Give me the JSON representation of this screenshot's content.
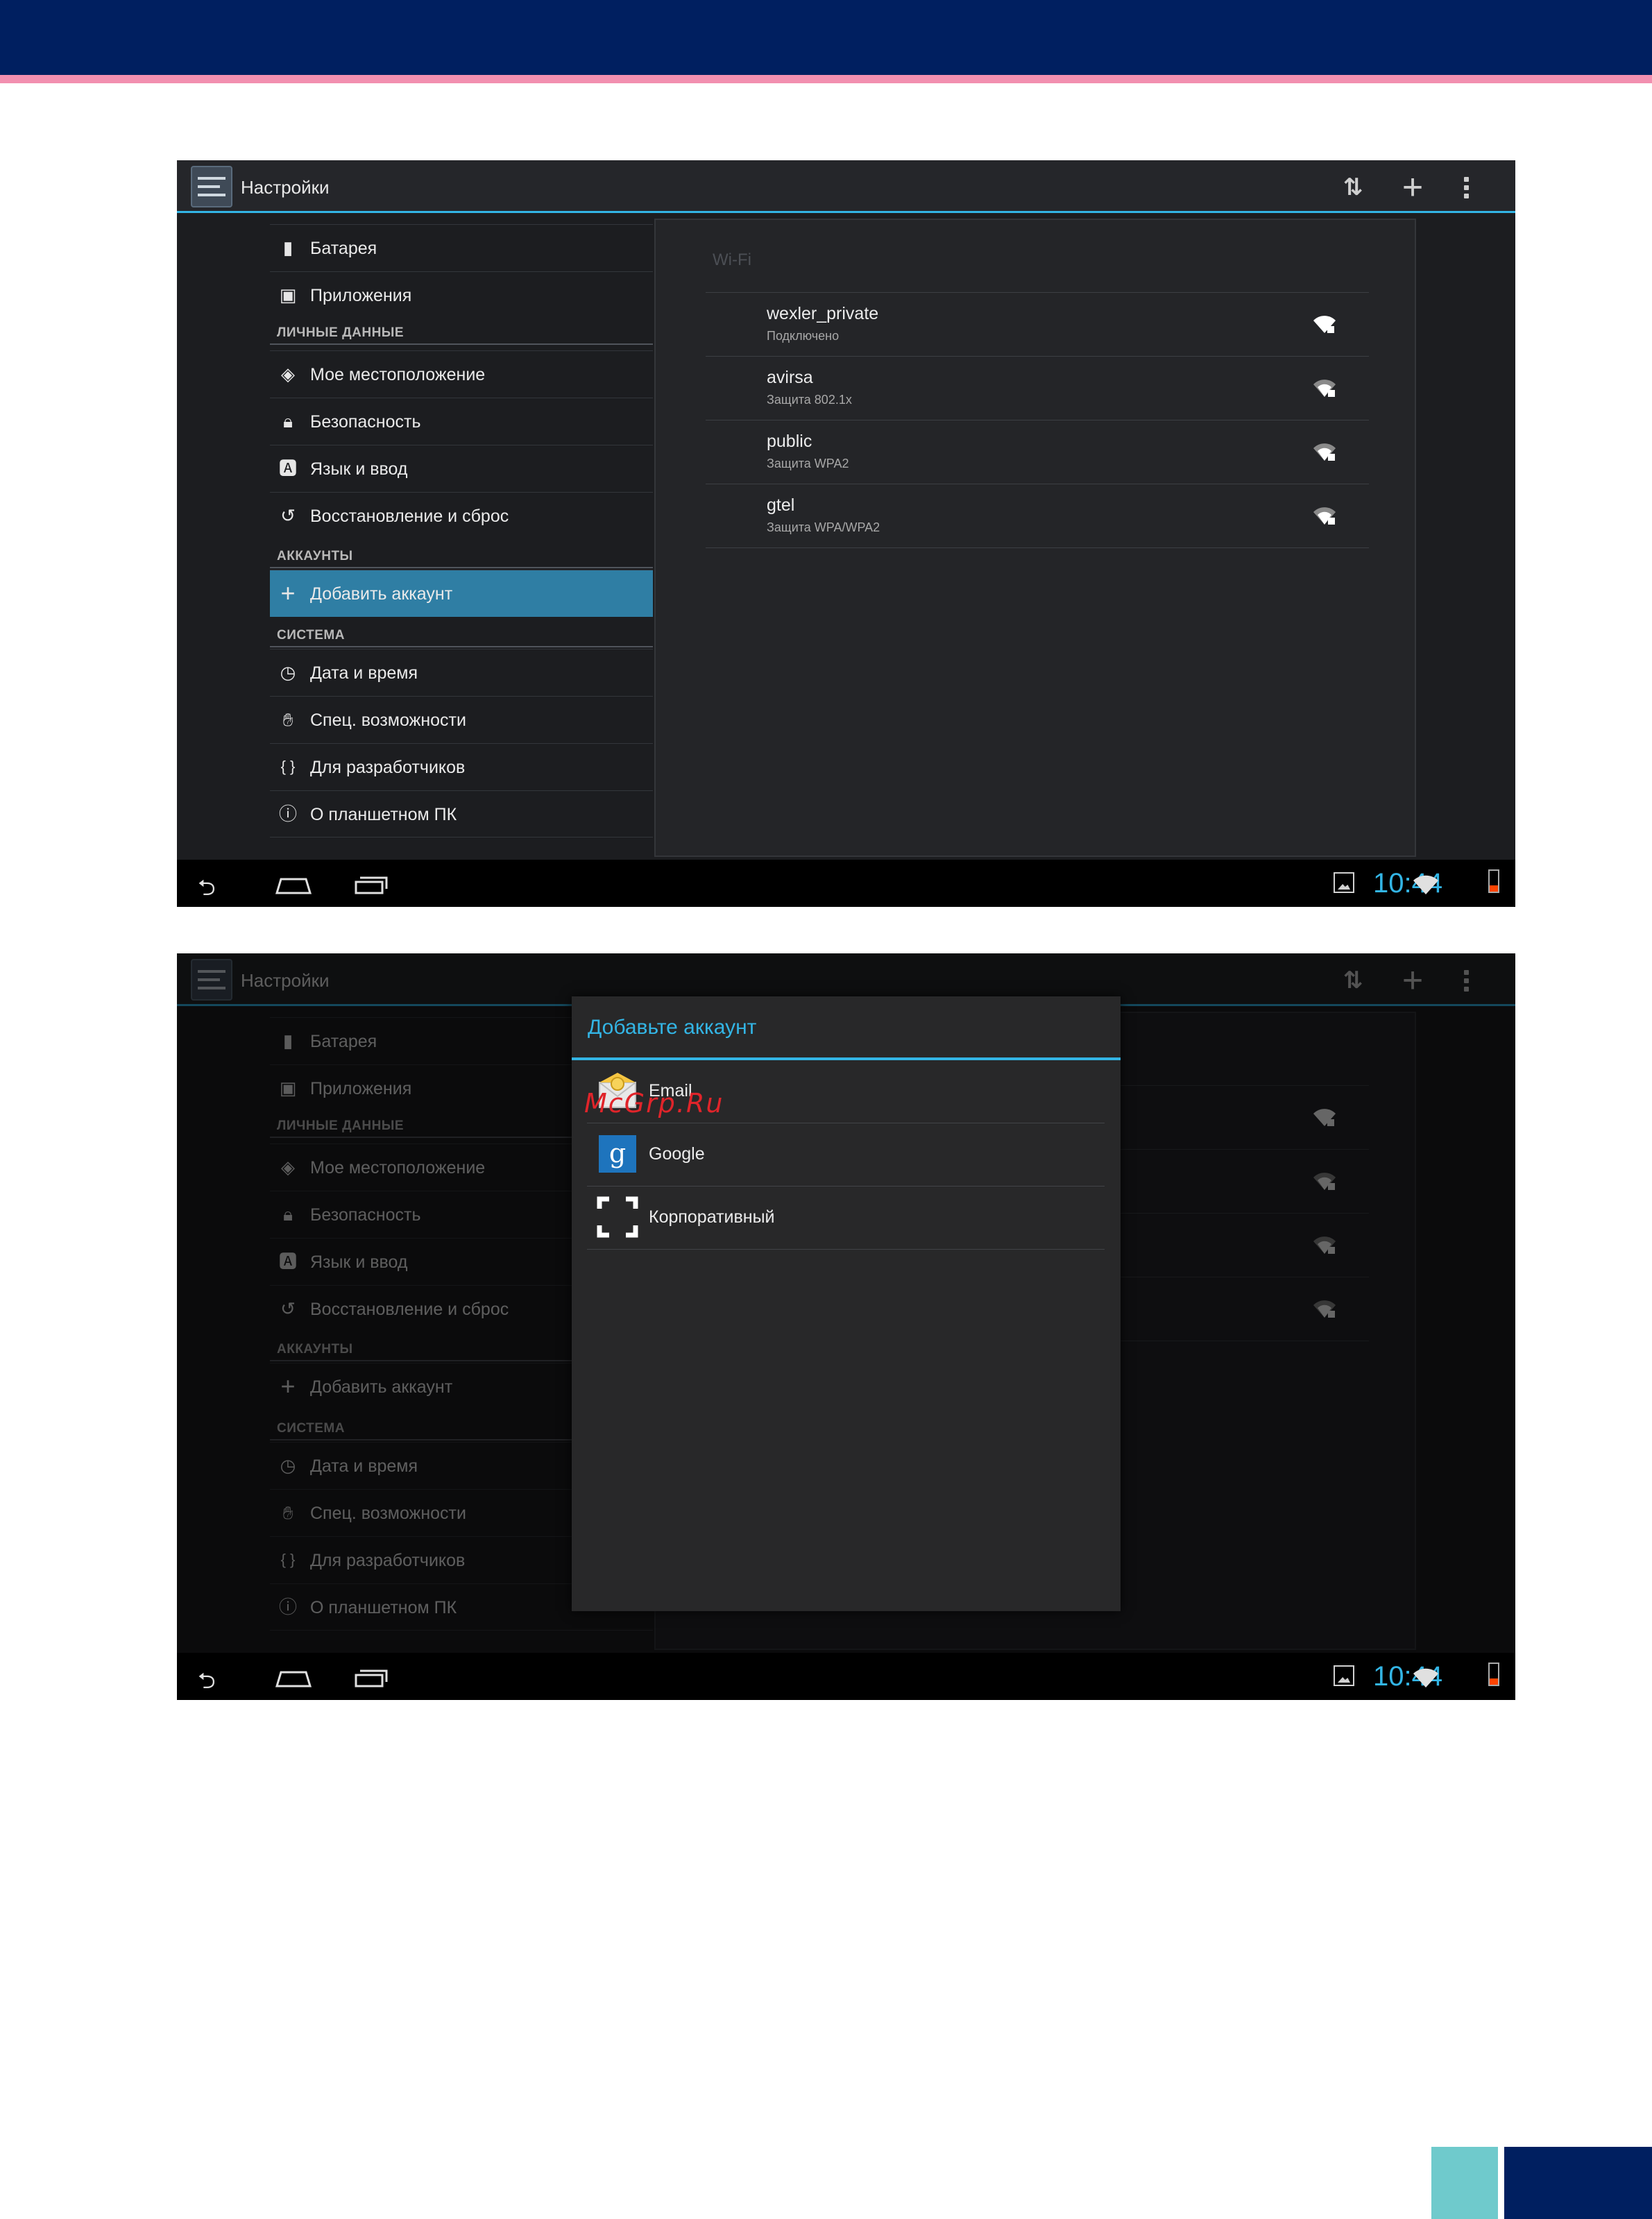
{
  "app": {
    "title": "Настройки"
  },
  "sidebar": {
    "items": [
      {
        "label": "Батарея",
        "icon": "battery-icon"
      },
      {
        "label": "Приложения",
        "icon": "apps-icon"
      }
    ],
    "section_personal": "ЛИЧНЫЕ ДАННЫЕ",
    "personal": [
      {
        "label": "Мое местоположение",
        "icon": "location-icon"
      },
      {
        "label": "Безопасность",
        "icon": "lock-icon"
      },
      {
        "label": "Язык и ввод",
        "icon": "language-icon"
      },
      {
        "label": "Восстановление и сброс",
        "icon": "reset-icon"
      }
    ],
    "section_accounts": "АККАУНТЫ",
    "add_account": "Добавить аккаунт",
    "section_system": "СИСТЕМА",
    "system": [
      {
        "label": "Дата и время",
        "icon": "clock-icon"
      },
      {
        "label": "Спец. возможности",
        "icon": "hand-icon"
      },
      {
        "label": "Для разработчиков",
        "icon": "braces-icon"
      },
      {
        "label": "О планшетном ПК",
        "icon": "info-icon"
      }
    ]
  },
  "wifi": {
    "title": "Wi-Fi",
    "networks": [
      {
        "name": "wexler_private",
        "status": "Подключено"
      },
      {
        "name": "avirsa",
        "status": "Защита 802.1x"
      },
      {
        "name": "public",
        "status": "Защита WPA2"
      },
      {
        "name": "gtel",
        "status": "Защита WPA/WPA2"
      }
    ]
  },
  "status": {
    "time": "10:44"
  },
  "dialog": {
    "title": "Добавьте аккаунт",
    "options": [
      {
        "label": "Email",
        "icon": "email-icon"
      },
      {
        "label": "Google",
        "icon": "google-icon"
      },
      {
        "label": "Корпоративный",
        "icon": "corporate-icon"
      }
    ]
  },
  "watermark": "McGrp.Ru",
  "colors": {
    "accent": "#33b5e5",
    "selected": "#2f7ea4",
    "brand_navy": "#001f60",
    "brand_pink": "#f28fb0",
    "brand_teal": "#6fcacc"
  }
}
